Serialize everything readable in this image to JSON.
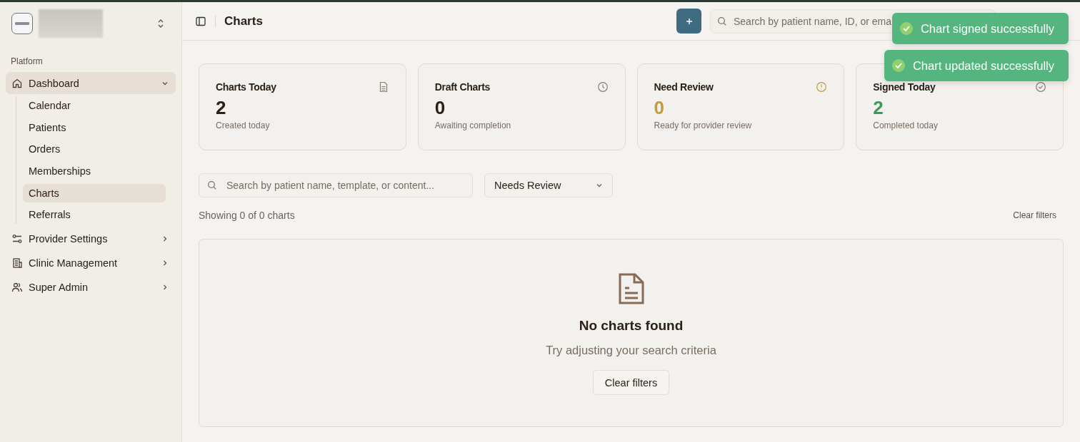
{
  "sidebar": {
    "section_label": "Platform",
    "items": [
      {
        "label": "Dashboard",
        "selected": true,
        "expanded": true,
        "children": [
          {
            "label": "Calendar",
            "selected": false
          },
          {
            "label": "Patients",
            "selected": false
          },
          {
            "label": "Orders",
            "selected": false
          },
          {
            "label": "Memberships",
            "selected": false
          },
          {
            "label": "Charts",
            "selected": true
          },
          {
            "label": "Referrals",
            "selected": false
          }
        ]
      },
      {
        "label": "Provider Settings",
        "selected": false,
        "expanded": false
      },
      {
        "label": "Clinic Management",
        "selected": false,
        "expanded": false
      },
      {
        "label": "Super Admin",
        "selected": false,
        "expanded": false
      }
    ]
  },
  "header": {
    "title": "Charts",
    "search": {
      "placeholder": "Search by patient name, ID, or ema"
    }
  },
  "toasts": [
    {
      "message": "Chart signed successfully"
    },
    {
      "message": "Chart updated successfully"
    }
  ],
  "stats": [
    {
      "title": "Charts Today",
      "value": "2",
      "caption": "Created today",
      "color": "#2b2118"
    },
    {
      "title": "Draft Charts",
      "value": "0",
      "caption": "Awaiting completion",
      "color": "#2b2118"
    },
    {
      "title": "Need Review",
      "value": "0",
      "caption": "Ready for provider review",
      "color": "#c59a3a"
    },
    {
      "title": "Signed Today",
      "value": "2",
      "caption": "Completed today",
      "color": "#3f9a5a"
    }
  ],
  "filters": {
    "search": {
      "placeholder": "Search by patient name, template, or content..."
    },
    "status": "Needs Review",
    "showing": "Showing 0 of 0 charts",
    "clear": "Clear filters"
  },
  "empty_state": {
    "title": "No charts found",
    "message": "Try adjusting your search criteria",
    "button": "Clear filters"
  }
}
